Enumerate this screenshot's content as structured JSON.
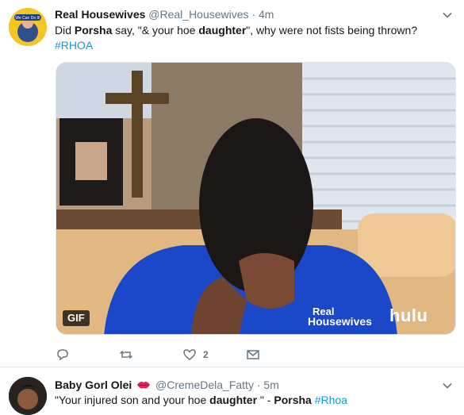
{
  "tweet1": {
    "name": "Real Housewives",
    "handle": "@Real_Housewives",
    "separator": "·",
    "time": "4m",
    "text_parts": [
      "Did ",
      "Porsha",
      " say, \"& your hoe ",
      "daughter",
      "\", why were not fists being thrown?"
    ],
    "hashtag": "#RHOA",
    "avatar_text": "We Can Do It!",
    "media": {
      "badge": "GIF",
      "logo_line1": "Real",
      "logo_line2": "Housewives",
      "brand": "hulu"
    },
    "actions": {
      "reply_count": "",
      "retweet_count": "",
      "like_count": "2"
    }
  },
  "tweet2": {
    "name": "Baby Gorl Olei",
    "handle": "@CremeDela_Fatty",
    "separator": "·",
    "time": "5m",
    "text_parts": [
      "\"Your injured son and your hoe ",
      "daughter",
      " \" - ",
      "Porsha",
      " "
    ],
    "hashtag": "#Rhoa"
  },
  "colors": {
    "link": "#1b95e0",
    "secondary": "#657786",
    "divider": "#e6ecf0"
  }
}
